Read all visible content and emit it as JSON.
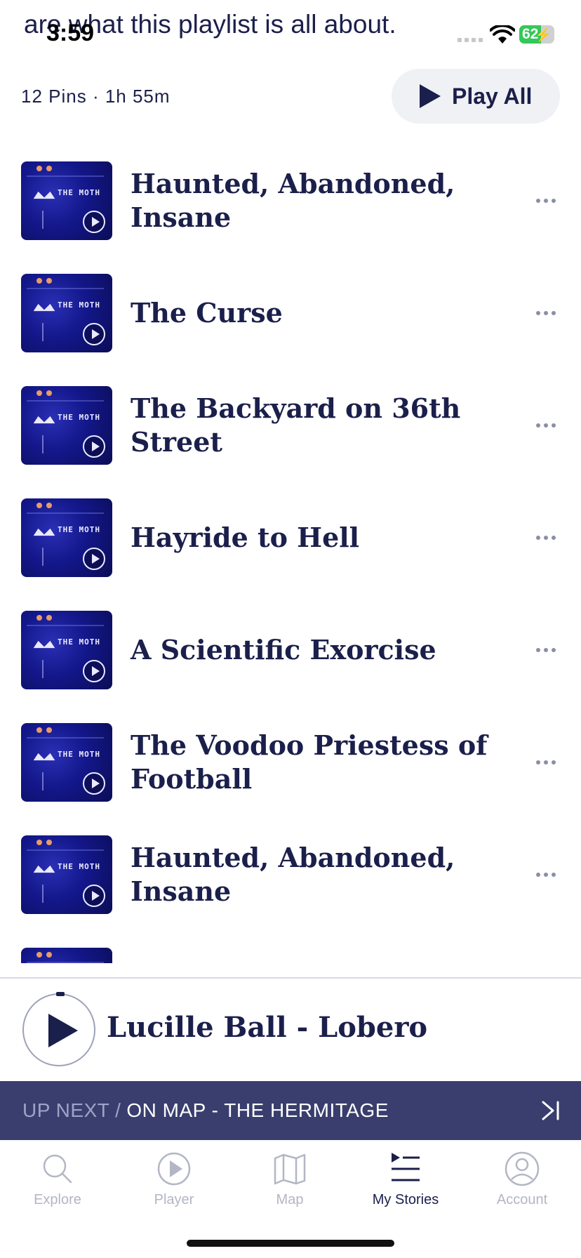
{
  "status_bar": {
    "overlap_text": "are what this playlist is all about.",
    "time": "3:59",
    "battery_pct": "62",
    "battery_level": 0.62
  },
  "header": {
    "meta": "12 Pins · 1h 55m",
    "play_all_label": "Play All"
  },
  "playlist": {
    "items": [
      {
        "title": "Haunted, Abandoned, Insane"
      },
      {
        "title": "The Curse"
      },
      {
        "title": "The Backyard on 36th Street"
      },
      {
        "title": "Hayride to Hell"
      },
      {
        "title": "A Scientific Exorcise"
      },
      {
        "title": "The Voodoo Priestess of Football"
      },
      {
        "title": "Haunted, Abandoned, Insane"
      },
      {
        "title": ""
      }
    ],
    "thumb_text": "THE MOTH"
  },
  "now_playing": {
    "title": "Lucille Ball - Lobero"
  },
  "up_next": {
    "lead": "UP NEXT /",
    "name": "ON MAP - THE HERMITAGE"
  },
  "tabs": [
    {
      "label": "Explore",
      "icon": "search-icon",
      "active": false
    },
    {
      "label": "Player",
      "icon": "play-circle-icon",
      "active": false
    },
    {
      "label": "Map",
      "icon": "map-icon",
      "active": false
    },
    {
      "label": "My Stories",
      "icon": "playlist-icon",
      "active": true
    },
    {
      "label": "Account",
      "icon": "account-icon",
      "active": false
    }
  ],
  "colors": {
    "navy": "#1b1f4b",
    "up_next_bg": "#393e6e",
    "battery_green": "#34c759"
  }
}
